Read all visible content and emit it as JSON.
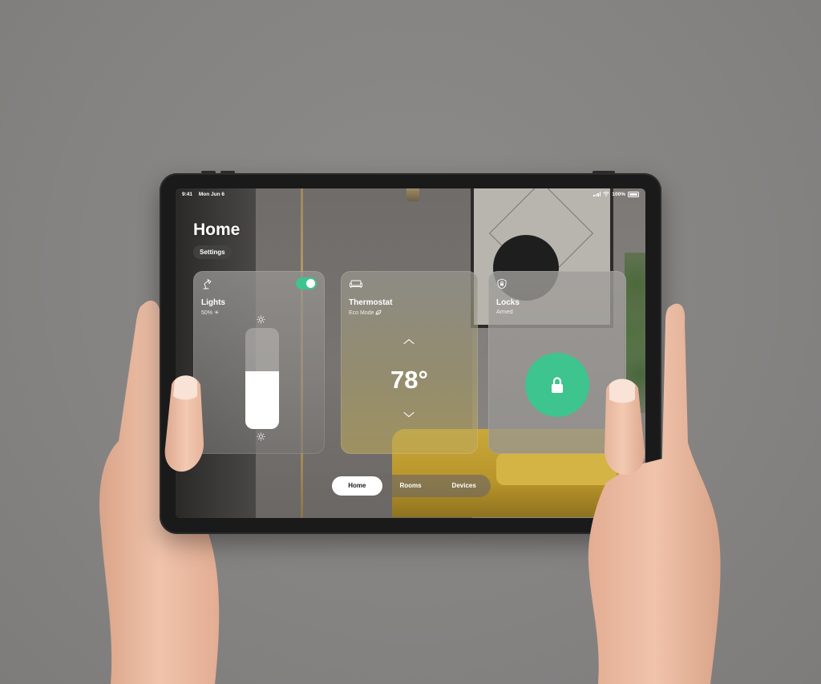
{
  "status_bar": {
    "time": "9:41",
    "date": "Mon Jun 6",
    "battery": "100%"
  },
  "header": {
    "title": "Home",
    "settings_label": "Settings"
  },
  "cards": {
    "lights": {
      "title": "Lights",
      "subtitle": "50% ☀",
      "icon": "desk-lamp-icon",
      "toggle_on": true,
      "brightness_fraction": 0.57
    },
    "thermostat": {
      "title": "Thermostat",
      "subtitle": "Eco Mode",
      "icon": "sofa-icon",
      "temperature": "78°"
    },
    "locks": {
      "title": "Locks",
      "subtitle": "Armed",
      "icon": "shield-lock-icon",
      "lock_icon": "padlock-icon"
    }
  },
  "tabbar": {
    "tabs": [
      {
        "label": "Home",
        "active": true
      },
      {
        "label": "Rooms",
        "active": false
      },
      {
        "label": "Devices",
        "active": false
      }
    ]
  },
  "colors": {
    "accent_green": "#3ec48e",
    "background": "#878584"
  }
}
